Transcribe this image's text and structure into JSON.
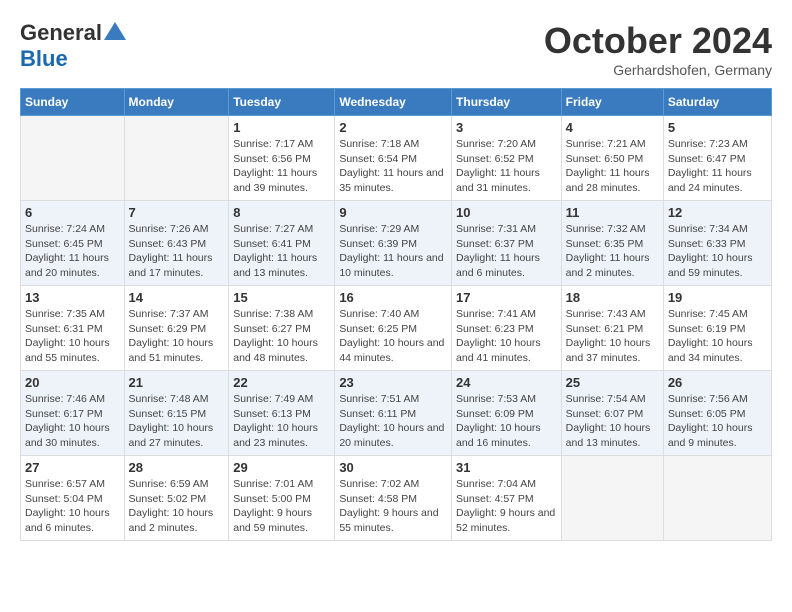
{
  "header": {
    "logo_general": "General",
    "logo_blue": "Blue",
    "month_title": "October 2024",
    "location": "Gerhardshofen, Germany"
  },
  "days_of_week": [
    "Sunday",
    "Monday",
    "Tuesday",
    "Wednesday",
    "Thursday",
    "Friday",
    "Saturday"
  ],
  "weeks": [
    [
      {
        "day": "",
        "sunrise": "",
        "sunset": "",
        "daylight": ""
      },
      {
        "day": "",
        "sunrise": "",
        "sunset": "",
        "daylight": ""
      },
      {
        "day": "1",
        "sunrise": "Sunrise: 7:17 AM",
        "sunset": "Sunset: 6:56 PM",
        "daylight": "Daylight: 11 hours and 39 minutes."
      },
      {
        "day": "2",
        "sunrise": "Sunrise: 7:18 AM",
        "sunset": "Sunset: 6:54 PM",
        "daylight": "Daylight: 11 hours and 35 minutes."
      },
      {
        "day": "3",
        "sunrise": "Sunrise: 7:20 AM",
        "sunset": "Sunset: 6:52 PM",
        "daylight": "Daylight: 11 hours and 31 minutes."
      },
      {
        "day": "4",
        "sunrise": "Sunrise: 7:21 AM",
        "sunset": "Sunset: 6:50 PM",
        "daylight": "Daylight: 11 hours and 28 minutes."
      },
      {
        "day": "5",
        "sunrise": "Sunrise: 7:23 AM",
        "sunset": "Sunset: 6:47 PM",
        "daylight": "Daylight: 11 hours and 24 minutes."
      }
    ],
    [
      {
        "day": "6",
        "sunrise": "Sunrise: 7:24 AM",
        "sunset": "Sunset: 6:45 PM",
        "daylight": "Daylight: 11 hours and 20 minutes."
      },
      {
        "day": "7",
        "sunrise": "Sunrise: 7:26 AM",
        "sunset": "Sunset: 6:43 PM",
        "daylight": "Daylight: 11 hours and 17 minutes."
      },
      {
        "day": "8",
        "sunrise": "Sunrise: 7:27 AM",
        "sunset": "Sunset: 6:41 PM",
        "daylight": "Daylight: 11 hours and 13 minutes."
      },
      {
        "day": "9",
        "sunrise": "Sunrise: 7:29 AM",
        "sunset": "Sunset: 6:39 PM",
        "daylight": "Daylight: 11 hours and 10 minutes."
      },
      {
        "day": "10",
        "sunrise": "Sunrise: 7:31 AM",
        "sunset": "Sunset: 6:37 PM",
        "daylight": "Daylight: 11 hours and 6 minutes."
      },
      {
        "day": "11",
        "sunrise": "Sunrise: 7:32 AM",
        "sunset": "Sunset: 6:35 PM",
        "daylight": "Daylight: 11 hours and 2 minutes."
      },
      {
        "day": "12",
        "sunrise": "Sunrise: 7:34 AM",
        "sunset": "Sunset: 6:33 PM",
        "daylight": "Daylight: 10 hours and 59 minutes."
      }
    ],
    [
      {
        "day": "13",
        "sunrise": "Sunrise: 7:35 AM",
        "sunset": "Sunset: 6:31 PM",
        "daylight": "Daylight: 10 hours and 55 minutes."
      },
      {
        "day": "14",
        "sunrise": "Sunrise: 7:37 AM",
        "sunset": "Sunset: 6:29 PM",
        "daylight": "Daylight: 10 hours and 51 minutes."
      },
      {
        "day": "15",
        "sunrise": "Sunrise: 7:38 AM",
        "sunset": "Sunset: 6:27 PM",
        "daylight": "Daylight: 10 hours and 48 minutes."
      },
      {
        "day": "16",
        "sunrise": "Sunrise: 7:40 AM",
        "sunset": "Sunset: 6:25 PM",
        "daylight": "Daylight: 10 hours and 44 minutes."
      },
      {
        "day": "17",
        "sunrise": "Sunrise: 7:41 AM",
        "sunset": "Sunset: 6:23 PM",
        "daylight": "Daylight: 10 hours and 41 minutes."
      },
      {
        "day": "18",
        "sunrise": "Sunrise: 7:43 AM",
        "sunset": "Sunset: 6:21 PM",
        "daylight": "Daylight: 10 hours and 37 minutes."
      },
      {
        "day": "19",
        "sunrise": "Sunrise: 7:45 AM",
        "sunset": "Sunset: 6:19 PM",
        "daylight": "Daylight: 10 hours and 34 minutes."
      }
    ],
    [
      {
        "day": "20",
        "sunrise": "Sunrise: 7:46 AM",
        "sunset": "Sunset: 6:17 PM",
        "daylight": "Daylight: 10 hours and 30 minutes."
      },
      {
        "day": "21",
        "sunrise": "Sunrise: 7:48 AM",
        "sunset": "Sunset: 6:15 PM",
        "daylight": "Daylight: 10 hours and 27 minutes."
      },
      {
        "day": "22",
        "sunrise": "Sunrise: 7:49 AM",
        "sunset": "Sunset: 6:13 PM",
        "daylight": "Daylight: 10 hours and 23 minutes."
      },
      {
        "day": "23",
        "sunrise": "Sunrise: 7:51 AM",
        "sunset": "Sunset: 6:11 PM",
        "daylight": "Daylight: 10 hours and 20 minutes."
      },
      {
        "day": "24",
        "sunrise": "Sunrise: 7:53 AM",
        "sunset": "Sunset: 6:09 PM",
        "daylight": "Daylight: 10 hours and 16 minutes."
      },
      {
        "day": "25",
        "sunrise": "Sunrise: 7:54 AM",
        "sunset": "Sunset: 6:07 PM",
        "daylight": "Daylight: 10 hours and 13 minutes."
      },
      {
        "day": "26",
        "sunrise": "Sunrise: 7:56 AM",
        "sunset": "Sunset: 6:05 PM",
        "daylight": "Daylight: 10 hours and 9 minutes."
      }
    ],
    [
      {
        "day": "27",
        "sunrise": "Sunrise: 6:57 AM",
        "sunset": "Sunset: 5:04 PM",
        "daylight": "Daylight: 10 hours and 6 minutes."
      },
      {
        "day": "28",
        "sunrise": "Sunrise: 6:59 AM",
        "sunset": "Sunset: 5:02 PM",
        "daylight": "Daylight: 10 hours and 2 minutes."
      },
      {
        "day": "29",
        "sunrise": "Sunrise: 7:01 AM",
        "sunset": "Sunset: 5:00 PM",
        "daylight": "Daylight: 9 hours and 59 minutes."
      },
      {
        "day": "30",
        "sunrise": "Sunrise: 7:02 AM",
        "sunset": "Sunset: 4:58 PM",
        "daylight": "Daylight: 9 hours and 55 minutes."
      },
      {
        "day": "31",
        "sunrise": "Sunrise: 7:04 AM",
        "sunset": "Sunset: 4:57 PM",
        "daylight": "Daylight: 9 hours and 52 minutes."
      },
      {
        "day": "",
        "sunrise": "",
        "sunset": "",
        "daylight": ""
      },
      {
        "day": "",
        "sunrise": "",
        "sunset": "",
        "daylight": ""
      }
    ]
  ]
}
